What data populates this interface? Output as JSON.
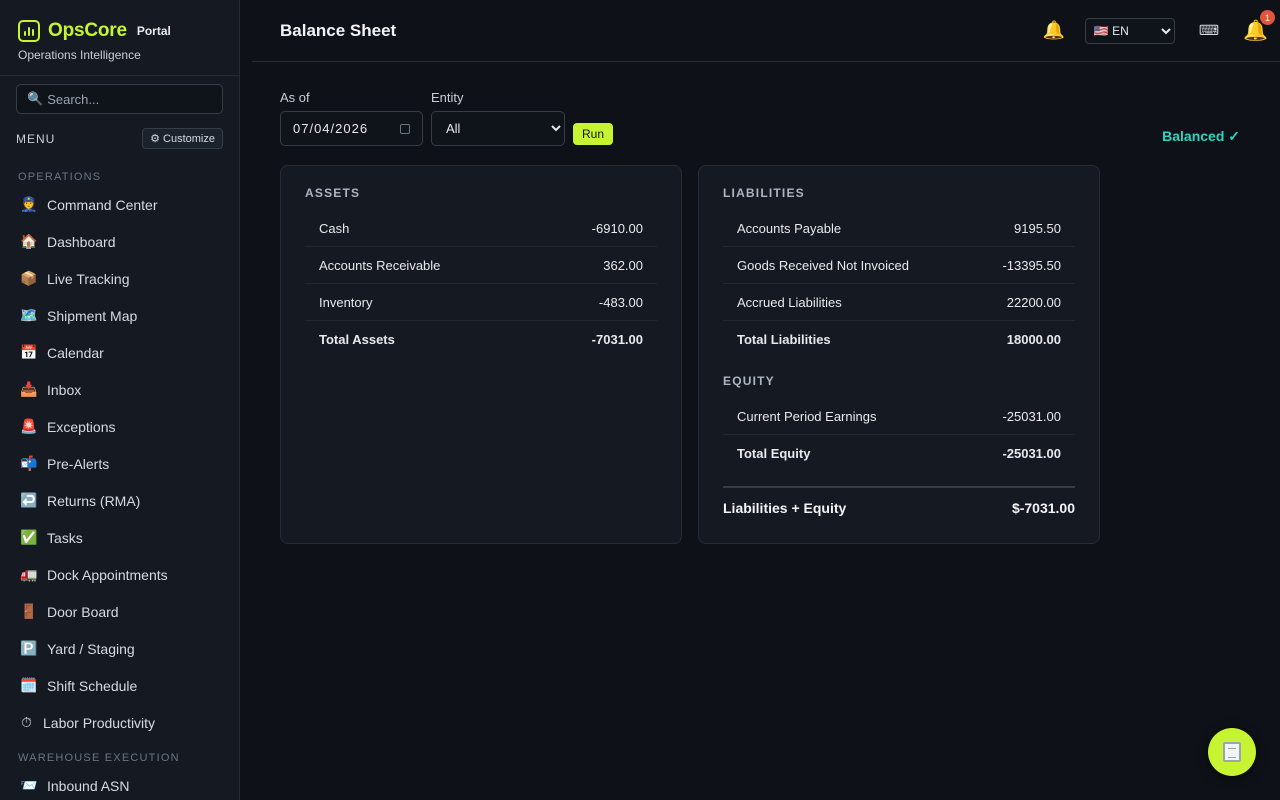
{
  "brand": {
    "name": "OpsCore",
    "suffix": "Portal",
    "tagline": "Operations Intelligence"
  },
  "search": {
    "placeholder": "Search..."
  },
  "menu": {
    "title": "MENU",
    "customize_label": "⚙ Customize",
    "sections": [
      {
        "label": "OPERATIONS",
        "items": [
          {
            "icon": "👮",
            "label": "Command Center"
          },
          {
            "icon": "🏠",
            "label": "Dashboard"
          },
          {
            "icon": "📦",
            "label": "Live Tracking"
          },
          {
            "icon": "🗺️",
            "label": "Shipment Map"
          },
          {
            "icon": "📅",
            "label": "Calendar"
          },
          {
            "icon": "📥",
            "label": "Inbox"
          },
          {
            "icon": "🚨",
            "label": "Exceptions"
          },
          {
            "icon": "📬",
            "label": "Pre-Alerts"
          },
          {
            "icon": "↩️",
            "label": "Returns (RMA)"
          },
          {
            "icon": "✅",
            "label": "Tasks"
          },
          {
            "icon": "🚛",
            "label": "Dock Appointments"
          },
          {
            "icon": "🚪",
            "label": "Door Board"
          },
          {
            "icon": "🅿️",
            "label": "Yard / Staging"
          },
          {
            "icon": "🗓️",
            "label": "Shift Schedule"
          },
          {
            "icon": "⏱",
            "label": "Labor Productivity"
          }
        ]
      },
      {
        "label": "WAREHOUSE EXECUTION",
        "items": [
          {
            "icon": "📨",
            "label": "Inbound ASN"
          }
        ]
      }
    ]
  },
  "header": {
    "title": "Balance Sheet",
    "language": "🇺🇸 EN",
    "notification_count": "1",
    "bell_glyph": "🔔",
    "keyboard_glyph": "⌨"
  },
  "filters": {
    "as_of_label": "As of",
    "as_of_value": "07/04/2026",
    "entity_label": "Entity",
    "entity_value": "All",
    "run_label": "Run"
  },
  "status": {
    "balanced": "Balanced ✓"
  },
  "assets": {
    "title": "ASSETS",
    "rows": [
      {
        "label": "Cash",
        "value": "-6910.00"
      },
      {
        "label": "Accounts Receivable",
        "value": "362.00"
      },
      {
        "label": "Inventory",
        "value": "-483.00"
      }
    ],
    "total": {
      "label": "Total Assets",
      "value": "-7031.00"
    }
  },
  "liabilities": {
    "title": "LIABILITIES",
    "rows": [
      {
        "label": "Accounts Payable",
        "value": "9195.50"
      },
      {
        "label": "Goods Received Not Invoiced",
        "value": "-13395.50"
      },
      {
        "label": "Accrued Liabilities",
        "value": "22200.00"
      }
    ],
    "total": {
      "label": "Total Liabilities",
      "value": "18000.00"
    }
  },
  "equity": {
    "title": "EQUITY",
    "rows": [
      {
        "label": "Current Period Earnings",
        "value": "-25031.00"
      }
    ],
    "total": {
      "label": "Total Equity",
      "value": "-25031.00"
    }
  },
  "liabilities_plus_equity": {
    "label": "Liabilities + Equity",
    "value": "$-7031.00"
  },
  "colors": {
    "accent": "#c6f432",
    "balanced": "#2dd4bf",
    "badge": "#e5533c",
    "background": "#0e1117"
  }
}
